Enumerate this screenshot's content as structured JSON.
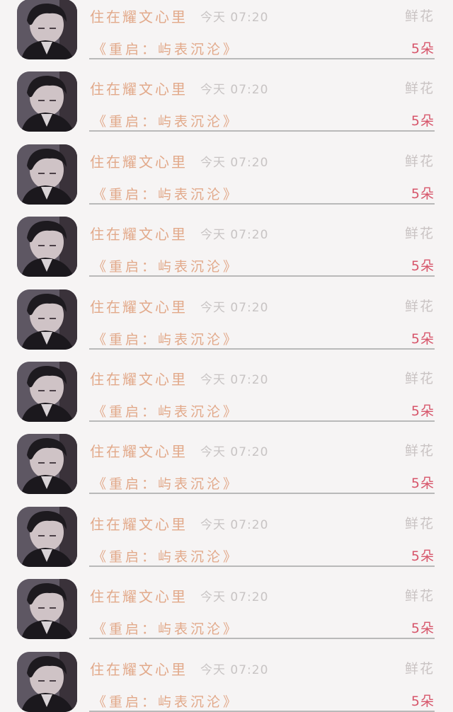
{
  "messages": [
    {
      "sender": "住在耀文心里",
      "time": "今天 07:20",
      "gift": "鲜花",
      "book": "《重启：屿表沉沦》",
      "count": "5朵",
      "avatar_icon": "user-avatar-photo"
    },
    {
      "sender": "住在耀文心里",
      "time": "今天 07:20",
      "gift": "鲜花",
      "book": "《重启：屿表沉沦》",
      "count": "5朵",
      "avatar_icon": "user-avatar-photo"
    },
    {
      "sender": "住在耀文心里",
      "time": "今天 07:20",
      "gift": "鲜花",
      "book": "《重启：屿表沉沦》",
      "count": "5朵",
      "avatar_icon": "user-avatar-photo"
    },
    {
      "sender": "住在耀文心里",
      "time": "今天 07:20",
      "gift": "鲜花",
      "book": "《重启：屿表沉沦》",
      "count": "5朵",
      "avatar_icon": "user-avatar-photo"
    },
    {
      "sender": "住在耀文心里",
      "time": "今天 07:20",
      "gift": "鲜花",
      "book": "《重启：屿表沉沦》",
      "count": "5朵",
      "avatar_icon": "user-avatar-photo"
    },
    {
      "sender": "住在耀文心里",
      "time": "今天 07:20",
      "gift": "鲜花",
      "book": "《重启：屿表沉沦》",
      "count": "5朵",
      "avatar_icon": "user-avatar-photo"
    },
    {
      "sender": "住在耀文心里",
      "time": "今天 07:20",
      "gift": "鲜花",
      "book": "《重启：屿表沉沦》",
      "count": "5朵",
      "avatar_icon": "user-avatar-photo"
    },
    {
      "sender": "住在耀文心里",
      "time": "今天 07:20",
      "gift": "鲜花",
      "book": "《重启：屿表沉沦》",
      "count": "5朵",
      "avatar_icon": "user-avatar-photo"
    },
    {
      "sender": "住在耀文心里",
      "time": "今天 07:20",
      "gift": "鲜花",
      "book": "《重启：屿表沉沦》",
      "count": "5朵",
      "avatar_icon": "user-avatar-photo"
    },
    {
      "sender": "住在耀文心里",
      "time": "今天 07:20",
      "gift": "鲜花",
      "book": "《重启：屿表沉沦》",
      "count": "5朵",
      "avatar_icon": "user-avatar-photo"
    }
  ],
  "colors": {
    "background": "#f6f4f4",
    "name_text": "#e2a98a",
    "time_text": "#c8c4c4",
    "gift_text": "#c9c3c3",
    "count_text": "#d7566b",
    "divider": "#b9b9b9"
  }
}
